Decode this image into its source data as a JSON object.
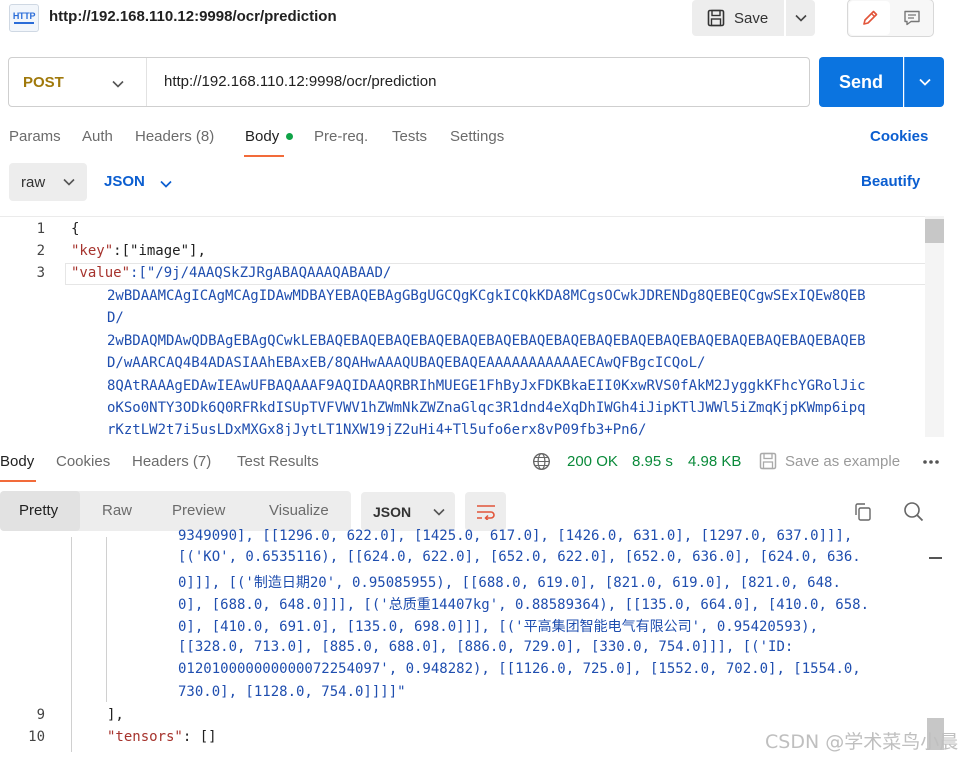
{
  "tab": {
    "icon_label": "HTTP",
    "url": "http://192.168.110.12:9998/ocr/prediction",
    "save_label": "Save"
  },
  "request": {
    "method": "POST",
    "url": "http://192.168.110.12:9998/ocr/prediction",
    "send_label": "Send"
  },
  "request_tabs": {
    "params": "Params",
    "auth": "Auth",
    "headers": "Headers (8)",
    "body": "Body",
    "prereq": "Pre-req.",
    "tests": "Tests",
    "settings": "Settings",
    "cookies": "Cookies"
  },
  "body_options": {
    "mode": "raw",
    "language": "JSON",
    "beautify": "Beautify"
  },
  "request_editor": {
    "line_numbers": [
      "1",
      "2",
      "3"
    ],
    "line1": "{",
    "line2_key": "\"key\"",
    "line2_rest": ":[\"image\"],",
    "line3_key": "\"value\"",
    "line3_rest": ":[\"/9j/4AAQSkZJRgABAQAAAQABAAD/",
    "wrapped": [
      "2wBDAAMCAgICAgMCAgIDAwMDBAYEBAQEBAgGBgUGCQgKCgkICQkKDA8MCgsOCwkJDRENDg8QEBEQCgwSExIQEw8QEB",
      "D/",
      "2wBDAQMDAwQDBAgEBAgQCwkLEBAQEBAQEBAQEBAQEBAQEBAQEBAQEBAQEBAQEBAQEBAQEBAQEBAQEBAQEBAQEBAQEB",
      "D/wAARCAQ4B4ADASIAAhEBAxEB/8QAHwAAAQUBAQEBAQEAAAAAAAAAAAECAwQFBgcICQoL/",
      "8QAtRAAAgEDAwIEAwUFBAQAAAF9AQIDAAQRBRIhMUEGE1FhByJxFDKBkaEII0KxwRVS0fAkM2JyggkKFhcYGRolJic",
      "oKSo0NTY3ODk6Q0RFRkdISUpTVFVWV1hZWmNkZWZnaGlqc3R1dnd4eXqDhIWGh4iJipKTlJWWl5iZmqKjpKWmp6ipq",
      "rKztLW2t7i5usLDxMXGx8jJytLT1NXW19jZ2uHi4+Tl5ufo6erx8vP09fb3+Pn6/"
    ]
  },
  "response_tabs": {
    "body": "Body",
    "cookies": "Cookies",
    "headers": "Headers (7)",
    "test_results": "Test Results",
    "status": "200 OK",
    "time": "8.95 s",
    "size": "4.98 KB",
    "save_example": "Save as example"
  },
  "response_format": {
    "pretty": "Pretty",
    "raw": "Raw",
    "preview": "Preview",
    "visualize": "Visualize",
    "language": "JSON"
  },
  "response_editor": {
    "lines": [
      "9349090], [[1296.0, 622.0], [1425.0, 617.0], [1426.0, 631.0], [1297.0, 637.0]]],",
      "[('KO', 0.6535116), [[624.0, 622.0], [652.0, 622.0], [652.0, 636.0], [624.0, 636.",
      "0]]], [('制造日期20', 0.95085955), [[688.0, 619.0], [821.0, 619.0], [821.0, 648.",
      "0], [688.0, 648.0]]], [('总质重14407kg', 0.88589364), [[135.0, 664.0], [410.0, 658.",
      "0], [410.0, 691.0], [135.0, 698.0]]], [('平高集团智能电气有限公司', 0.95420593),",
      "[[328.0, 713.0], [885.0, 688.0], [886.0, 729.0], [330.0, 754.0]]], [('ID:",
      "012010000000000072254097', 0.948282), [[1126.0, 725.0], [1552.0, 702.0], [1554.0,",
      "730.0], [1128.0, 754.0]]]]\""
    ],
    "line9_number": "9",
    "line9_text": "],",
    "line10_number": "10",
    "line10_key": "\"tensors\"",
    "line10_rest": ": []"
  },
  "watermark": "CSDN @学术菜鸟小晨"
}
